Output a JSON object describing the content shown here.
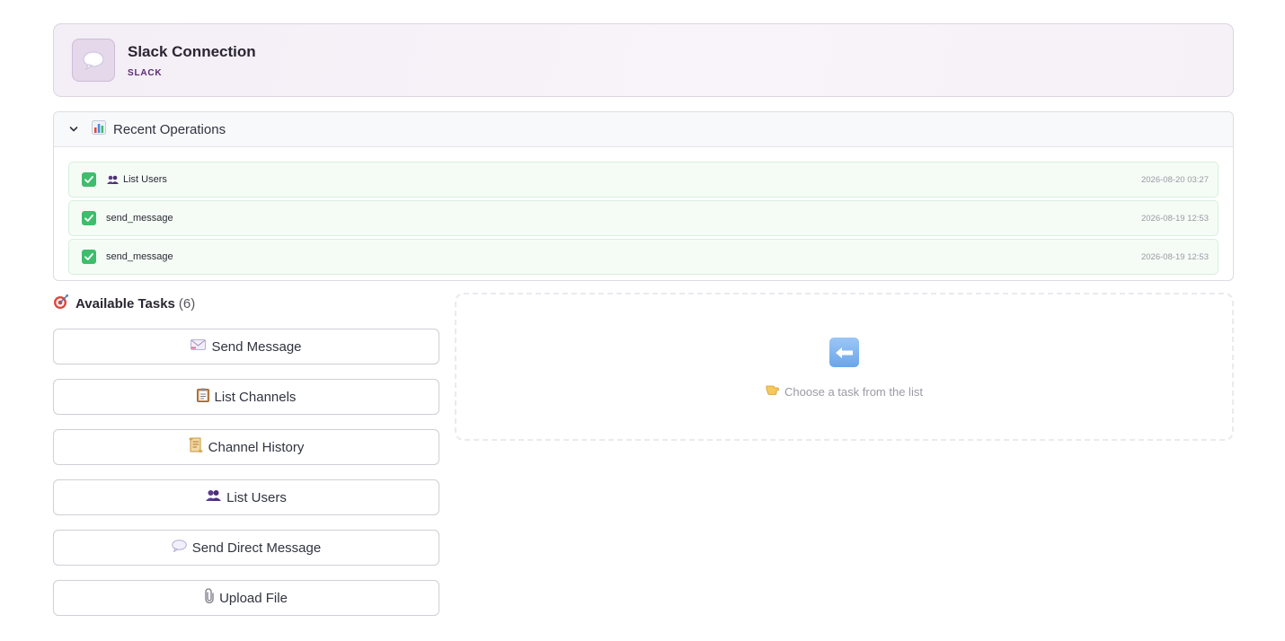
{
  "connection": {
    "title": "Slack Connection",
    "subtitle": "SLACK",
    "icon": "speech-bubble-icon"
  },
  "recent_operations": {
    "title": "Recent Operations",
    "icon": "bar-chart-icon",
    "items": [
      {
        "label": "List Users",
        "icon": "users-icon",
        "time": "2026-08-20 03:27",
        "status": "success"
      },
      {
        "label": "send_message",
        "time": "2026-08-19 12:53",
        "status": "success"
      },
      {
        "label": "send_message",
        "time": "2026-08-19 12:53",
        "status": "success"
      }
    ]
  },
  "tasks": {
    "title": "Available Tasks",
    "count": "(6)",
    "icon": "target-icon",
    "buttons": [
      {
        "label": "Send Message",
        "icon": "envelope-icon"
      },
      {
        "label": "List Channels",
        "icon": "clipboard-icon"
      },
      {
        "label": "Channel History",
        "icon": "scroll-icon"
      },
      {
        "label": "List Users",
        "icon": "users-icon"
      },
      {
        "label": "Send Direct Message",
        "icon": "speech-bubble-icon"
      },
      {
        "label": "Upload File",
        "icon": "paperclip-icon"
      }
    ]
  },
  "placeholder": {
    "icon": "left-arrow-icon",
    "hint_icon": "pointing-hand-icon",
    "text": "Choose a task from the list"
  },
  "colors": {
    "accent": "#5b2a73",
    "success": "#3ebd6d",
    "header_bg": "#f4eef6"
  }
}
